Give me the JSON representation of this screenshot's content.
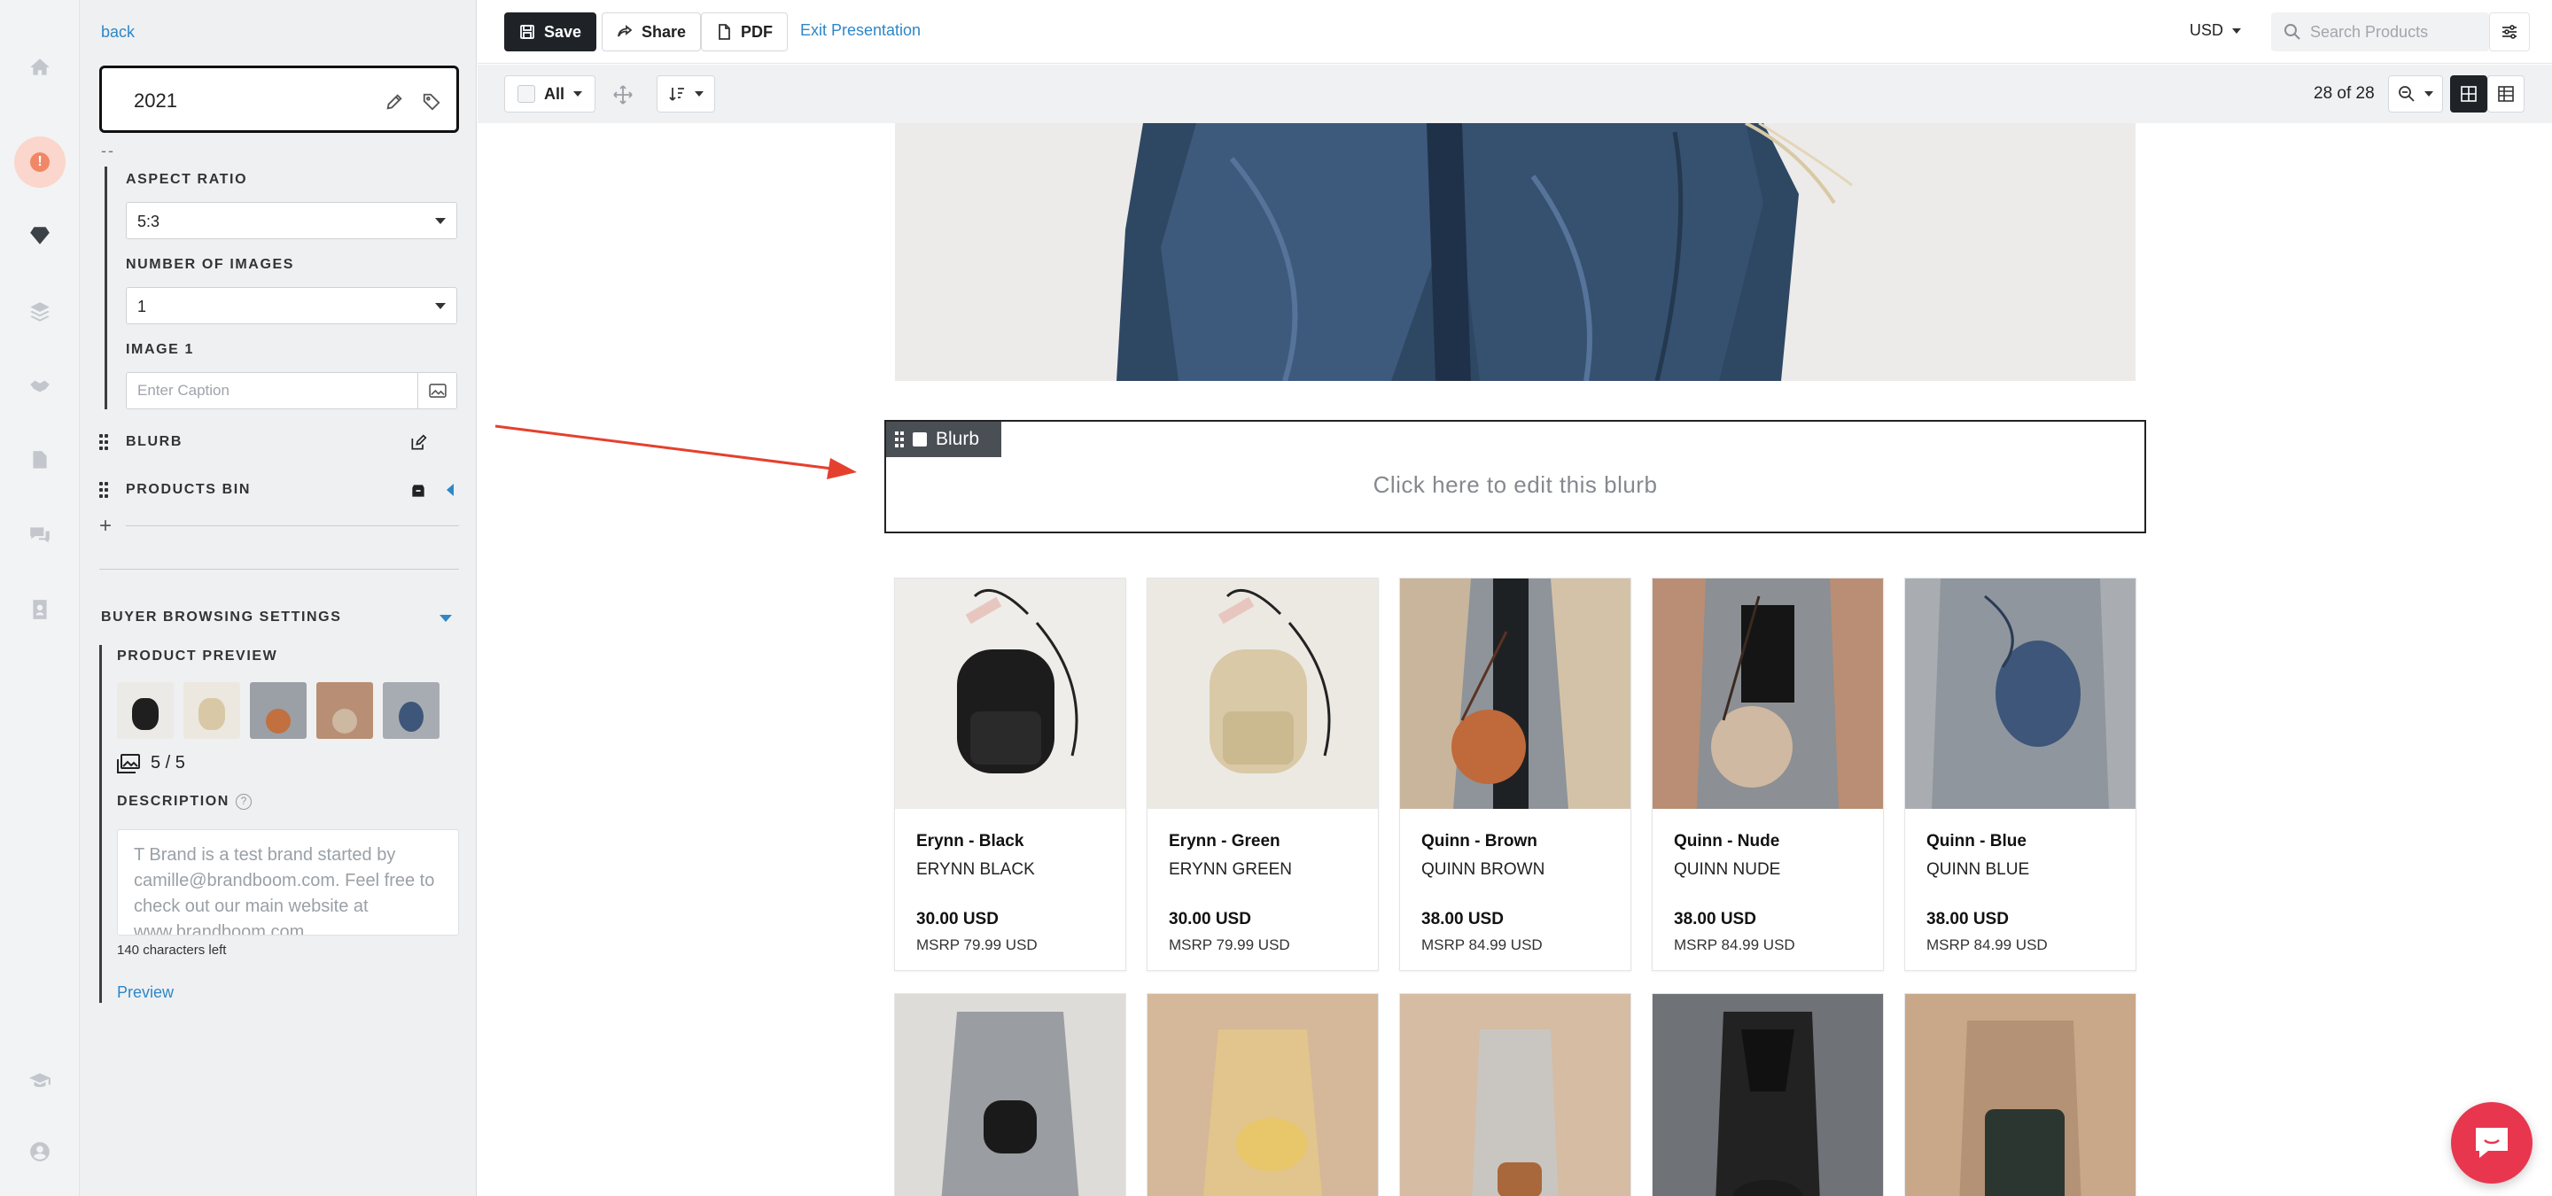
{
  "sidebar": {
    "back_label": "back",
    "section_title": "2021",
    "separator": "--",
    "aspect_ratio": {
      "label": "ASPECT RATIO",
      "value": "5:3"
    },
    "number_of_images": {
      "label": "NUMBER OF IMAGES",
      "value": "1"
    },
    "image1": {
      "label": "IMAGE 1",
      "caption_placeholder": "Enter Caption"
    },
    "blurb_label": "BLURB",
    "products_bin_label": "PRODUCTS BIN",
    "add_label": "+",
    "buyer_settings": {
      "title": "BUYER BROWSING SETTINGS",
      "product_preview_label": "PRODUCT PREVIEW",
      "count": "5 / 5",
      "description_label": "DESCRIPTION",
      "help": "?",
      "description_text": "T Brand is a test brand started by camille@brandboom.com. Feel free to check out our main website at www.brandboom.com",
      "chars_left": "140 characters left",
      "preview_label": "Preview"
    }
  },
  "toolbar": {
    "save_label": "Save",
    "share_label": "Share",
    "pdf_label": "PDF",
    "exit_label": "Exit Presentation",
    "currency": "USD",
    "search_placeholder": "Search Products"
  },
  "subbar": {
    "select_label": "All",
    "page_count": "28 of 28"
  },
  "blurb": {
    "tag_label": "Blurb",
    "placeholder": "Click here to edit this blurb"
  },
  "products": [
    {
      "name": "Erynn - Black",
      "sku": "ERYNN BLACK",
      "price": "30.00 USD",
      "msrp": "MSRP 79.99 USD"
    },
    {
      "name": "Erynn - Green",
      "sku": "ERYNN GREEN",
      "price": "30.00 USD",
      "msrp": "MSRP 79.99 USD"
    },
    {
      "name": "Quinn - Brown",
      "sku": "QUINN BROWN",
      "price": "38.00 USD",
      "msrp": "MSRP 84.99 USD"
    },
    {
      "name": "Quinn - Nude",
      "sku": "QUINN NUDE",
      "price": "38.00 USD",
      "msrp": "MSRP 84.99 USD"
    },
    {
      "name": "Quinn - Blue",
      "sku": "QUINN BLUE",
      "price": "38.00 USD",
      "msrp": "MSRP 84.99 USD"
    }
  ],
  "colors": {
    "accent": "#2d87c8",
    "dark": "#1f2328",
    "arrow": "#e5402e",
    "chat": "#e8364f"
  }
}
